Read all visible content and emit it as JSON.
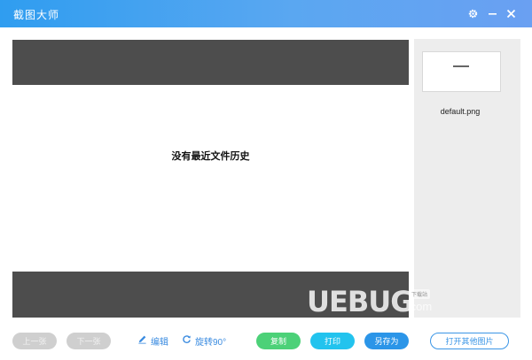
{
  "titlebar": {
    "title": "截图大师",
    "icons": [
      "gear-icon",
      "minimize-icon",
      "close-icon"
    ]
  },
  "viewer": {
    "empty_message": "没有最近文件历史"
  },
  "sidebar": {
    "thumbnails": [
      {
        "filename": "default.png"
      }
    ]
  },
  "watermark": {
    "text": "UEBUG",
    "badge": "下载站",
    "suffix": ".com"
  },
  "toolbar": {
    "prev_label": "上一张",
    "next_label": "下一张",
    "edit_label": "编辑",
    "rotate_label": "旋转90°",
    "copy_label": "复制",
    "print_label": "打印",
    "saveas_label": "另存为",
    "open_label": "打开其他图片"
  },
  "colors": {
    "titlebar": "#2f9df0",
    "accent": "#3a8be0",
    "copy": "#4cd178",
    "print": "#22c3ee",
    "saveas": "#2b95e8",
    "disabled": "#cfcfcf"
  }
}
